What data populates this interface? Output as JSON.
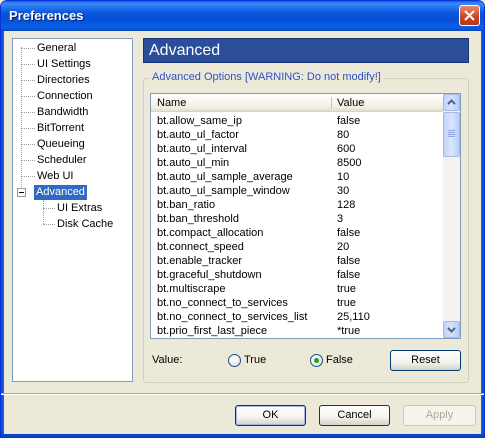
{
  "window": {
    "title": "Preferences"
  },
  "tree": {
    "items": [
      {
        "label": "General"
      },
      {
        "label": "UI Settings"
      },
      {
        "label": "Directories"
      },
      {
        "label": "Connection"
      },
      {
        "label": "Bandwidth"
      },
      {
        "label": "BitTorrent"
      },
      {
        "label": "Queueing"
      },
      {
        "label": "Scheduler"
      },
      {
        "label": "Web UI"
      },
      {
        "label": "Advanced",
        "selected": true,
        "expanded": true
      },
      {
        "label": "UI Extras"
      },
      {
        "label": "Disk Cache"
      }
    ]
  },
  "header": {
    "title": "Advanced"
  },
  "group": {
    "legend": "Advanced Options [WARNING: Do not modify!]"
  },
  "list": {
    "columns": [
      "Name",
      "Value"
    ],
    "rows": [
      [
        "bt.allow_same_ip",
        "false"
      ],
      [
        "bt.auto_ul_factor",
        "80"
      ],
      [
        "bt.auto_ul_interval",
        "600"
      ],
      [
        "bt.auto_ul_min",
        "8500"
      ],
      [
        "bt.auto_ul_sample_average",
        "10"
      ],
      [
        "bt.auto_ul_sample_window",
        "30"
      ],
      [
        "bt.ban_ratio",
        "128"
      ],
      [
        "bt.ban_threshold",
        "3"
      ],
      [
        "bt.compact_allocation",
        "false"
      ],
      [
        "bt.connect_speed",
        "20"
      ],
      [
        "bt.enable_tracker",
        "false"
      ],
      [
        "bt.graceful_shutdown",
        "false"
      ],
      [
        "bt.multiscrape",
        "true"
      ],
      [
        "bt.no_connect_to_services",
        "true"
      ],
      [
        "bt.no_connect_to_services_list",
        "25,110"
      ],
      [
        "bt.prio_first_last_piece",
        "*true"
      ]
    ]
  },
  "value_editor": {
    "label": "Value:",
    "true_label": "True",
    "false_label": "False",
    "selected": "False",
    "reset_label": "Reset"
  },
  "buttons": {
    "ok": "OK",
    "cancel": "Cancel",
    "apply": "Apply"
  },
  "colors": {
    "selection": "#316AC5",
    "header_bg": "#2B4E9A",
    "legend_text": "#2E53C8"
  }
}
